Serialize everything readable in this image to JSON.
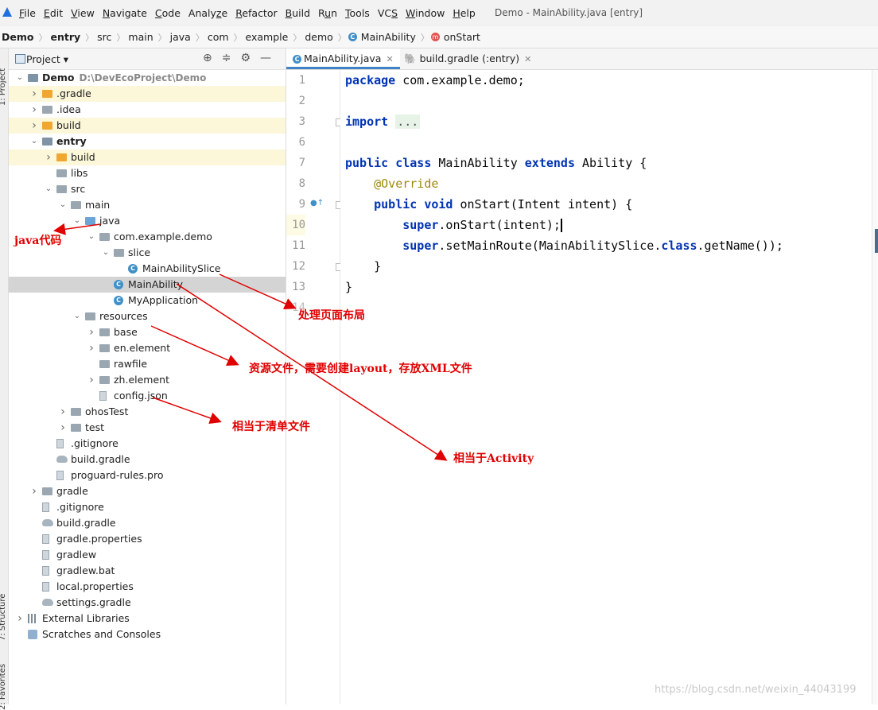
{
  "menubar": {
    "items": [
      "File",
      "Edit",
      "View",
      "Navigate",
      "Code",
      "Analyze",
      "Refactor",
      "Build",
      "Run",
      "Tools",
      "VCS",
      "Window",
      "Help"
    ],
    "mnemonics": [
      "F",
      "E",
      "V",
      "N",
      "C",
      "z",
      "R",
      "B",
      "u",
      "T",
      "S",
      "W",
      "H"
    ],
    "window_title": "Demo - MainAbility.java [entry]"
  },
  "breadcrumb": {
    "items": [
      "Demo",
      "entry",
      "src",
      "main",
      "java",
      "com",
      "example",
      "demo",
      "MainAbility",
      "onStart"
    ]
  },
  "sidebar_strip": {
    "project_label": "1: Project",
    "structure_label": "7: Structure",
    "favorites_label": "2: Favorites"
  },
  "project_panel": {
    "title": "Project",
    "rows": [
      {
        "label": "Demo",
        "path": "D:\\DevEcoProject\\Demo"
      },
      {
        "label": ".gradle"
      },
      {
        "label": ".idea"
      },
      {
        "label": "build"
      },
      {
        "label": "entry"
      },
      {
        "label": "build"
      },
      {
        "label": "libs"
      },
      {
        "label": "src"
      },
      {
        "label": "main"
      },
      {
        "label": "java"
      },
      {
        "label": "com.example.demo"
      },
      {
        "label": "slice"
      },
      {
        "label": "MainAbilitySlice"
      },
      {
        "label": "MainAbility"
      },
      {
        "label": "MyApplication"
      },
      {
        "label": "resources"
      },
      {
        "label": "base"
      },
      {
        "label": "en.element"
      },
      {
        "label": "rawfile"
      },
      {
        "label": "zh.element"
      },
      {
        "label": "config.json"
      },
      {
        "label": "ohosTest"
      },
      {
        "label": "test"
      },
      {
        "label": ".gitignore"
      },
      {
        "label": "build.gradle"
      },
      {
        "label": "proguard-rules.pro"
      },
      {
        "label": "gradle"
      },
      {
        "label": ".gitignore"
      },
      {
        "label": "build.gradle"
      },
      {
        "label": "gradle.properties"
      },
      {
        "label": "gradlew"
      },
      {
        "label": "gradlew.bat"
      },
      {
        "label": "local.properties"
      },
      {
        "label": "settings.gradle"
      },
      {
        "label": "External Libraries"
      },
      {
        "label": "Scratches and Consoles"
      }
    ]
  },
  "editor": {
    "tabs": [
      {
        "label": "MainAbility.java"
      },
      {
        "label": "build.gradle (:entry)"
      }
    ],
    "line_numbers": [
      "1",
      "2",
      "3",
      "6",
      "7",
      "8",
      "9",
      "10",
      "11",
      "12",
      "13",
      "14"
    ],
    "code": {
      "l1_kw": "package",
      "l1_rest": " com.example.demo;",
      "l3_kw": "import",
      "l3_rest": "...",
      "l7_kw1": "public class",
      "l7_mid": " MainAbility ",
      "l7_kw2": "extends",
      "l7_rest": " Ability {",
      "l8_ann": "@Override",
      "l9_kw": "public void",
      "l9_rest": " onStart(Intent intent) {",
      "l10_kw": "super",
      "l10_rest": ".onStart(intent);",
      "l11_kw": "super",
      "l11_mid": ".setMainRoute(MainAbilitySlice.",
      "l11_kw2": "class",
      "l11_rest": ".getName());",
      "l12": "}",
      "l13": "}"
    }
  },
  "annotations": {
    "java_code": "java代码",
    "page_layout": "处理页面布局",
    "resources": "资源文件，需要创建layout，存放XML文件",
    "manifest": "相当于清单文件",
    "activity": "相当于Activity"
  },
  "watermark": "https://blog.csdn.net/weixin_44043199",
  "colors": {
    "annotation": "#e00000",
    "keyword": "#0033b3",
    "annotation_code": "#9e880d",
    "highlight_row": "#fcf7d9"
  }
}
